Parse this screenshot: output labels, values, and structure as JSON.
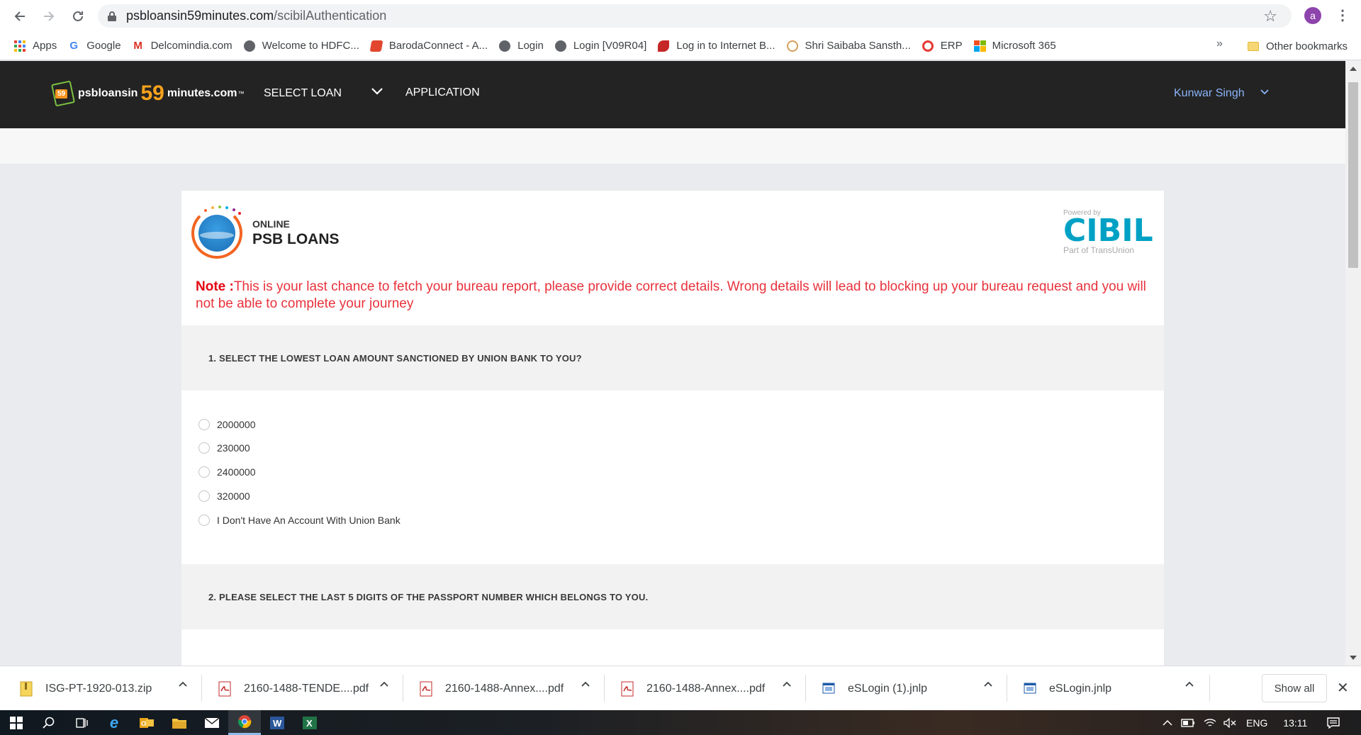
{
  "browser": {
    "url_domain": "psbloansin59minutes.com",
    "url_path": "/scibilAuthentication",
    "profile_initial": "a",
    "bookmarks": [
      {
        "label": "Apps",
        "icon": "apps-grid-icon"
      },
      {
        "label": "Google",
        "icon": "google-icon",
        "color": "#4285f4"
      },
      {
        "label": "Delcomindia.com",
        "icon": "gmail-icon",
        "color": "#d93025"
      },
      {
        "label": "Welcome to HDFC...",
        "icon": "globe-icon",
        "color": "#5f6368"
      },
      {
        "label": "BarodaConnect - A...",
        "icon": "baroda-icon",
        "color": "#e2462f"
      },
      {
        "label": "Login",
        "icon": "globe-icon",
        "color": "#5f6368"
      },
      {
        "label": "Login [V09R04]",
        "icon": "globe-icon",
        "color": "#5f6368"
      },
      {
        "label": "Log in to Internet B...",
        "icon": "bank-icon",
        "color": "#c62828"
      },
      {
        "label": "Shri Saibaba Sansth...",
        "icon": "temple-icon",
        "color": "#d4a05a"
      },
      {
        "label": "ERP",
        "icon": "erp-icon",
        "color": "#e53935"
      },
      {
        "label": "Microsoft 365",
        "icon": "microsoft-icon",
        "color": "#f25022"
      }
    ],
    "bookmarks_more": "»",
    "other_bookmarks": "Other bookmarks"
  },
  "site": {
    "logo_part1": "psbloansin",
    "logo_59": "59",
    "logo_part2": "minutes.com",
    "logo_tm": "™",
    "logo_badge_num": "59",
    "nav_select_loan": "SELECT LOAN",
    "nav_application": "APPLICATION",
    "user_name": "Kunwar Singh"
  },
  "card": {
    "psb_online": "ONLINE",
    "psb_loans": "PSB LOANS",
    "cibil_powered": "Powered by",
    "cibil_word": "CIBIL",
    "cibil_sub": "Part of TransUnion",
    "note_label": "Note :",
    "note_text": "This is your last chance to fetch your bureau report, please provide correct details. Wrong details will lead to blocking up your bureau request and you will not be able to complete your journey"
  },
  "questions": [
    {
      "title": "1. SELECT THE LOWEST LOAN AMOUNT SANCTIONED BY UNION BANK TO YOU?",
      "options": [
        "2000000",
        "230000",
        "2400000",
        "320000",
        "I Don't Have An Account With Union Bank"
      ]
    },
    {
      "title": "2. PLEASE SELECT THE LAST 5 DIGITS OF THE PASSPORT NUMBER WHICH BELONGS TO YOU.",
      "options": []
    }
  ],
  "downloads": [
    {
      "name": "ISG-PT-1920-013.zip",
      "icon": "zip-file-icon"
    },
    {
      "name": "2160-1488-TENDE....pdf",
      "icon": "pdf-file-icon"
    },
    {
      "name": "2160-1488-Annex....pdf",
      "icon": "pdf-file-icon"
    },
    {
      "name": "2160-1488-Annex....pdf",
      "icon": "pdf-file-icon"
    },
    {
      "name": "eSLogin (1).jnlp",
      "icon": "jnlp-file-icon"
    },
    {
      "name": "eSLogin.jnlp",
      "icon": "jnlp-file-icon"
    }
  ],
  "show_all": "Show all",
  "taskbar": {
    "language": "ENG",
    "time": "13:11"
  },
  "colors": {
    "nav_bg": "#232323",
    "note_red": "#e8323c",
    "cibil_blue": "#00a1c4",
    "logo_orange": "#f7a21d",
    "user_link": "#8ab4f8"
  }
}
